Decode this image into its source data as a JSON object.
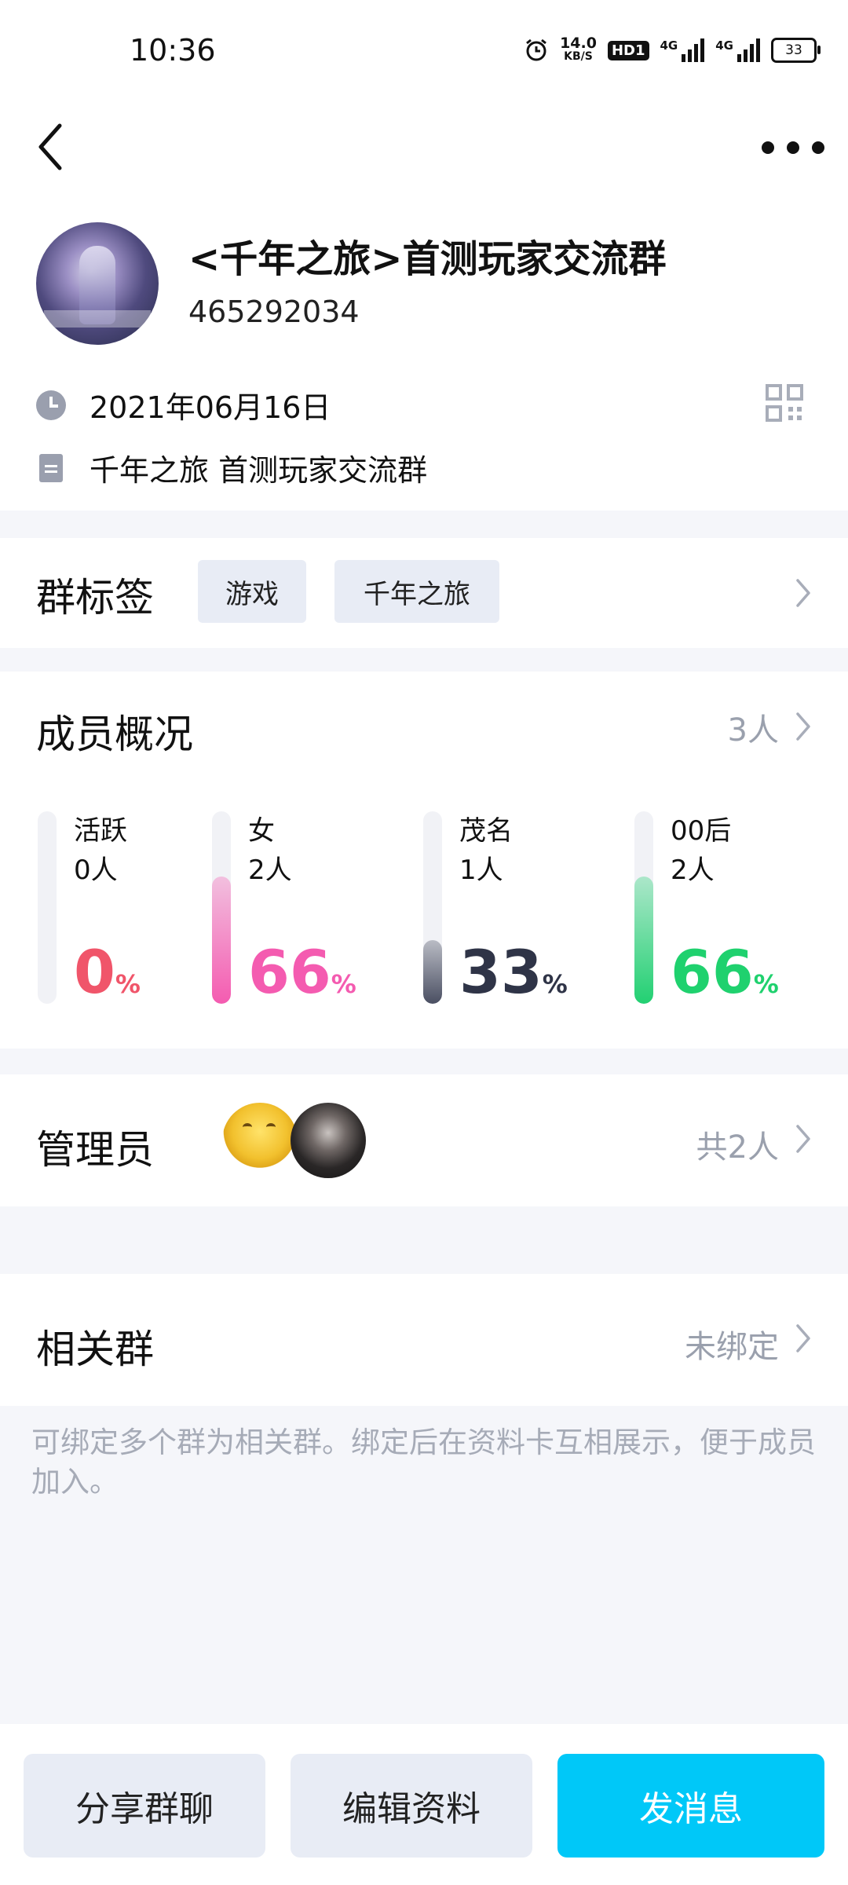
{
  "status_bar": {
    "time": "10:36",
    "speed_value": "14.0",
    "speed_unit": "KB/S",
    "hd_label": "HD1",
    "network1": "4G",
    "network2": "4G",
    "battery": "33"
  },
  "group": {
    "name": "<千年之旅>首测玩家交流群",
    "id": "465292034",
    "created_date": "2021年06月16日",
    "description": "千年之旅 首测玩家交流群"
  },
  "tags": {
    "title": "群标签",
    "items": [
      "游戏",
      "千年之旅"
    ]
  },
  "members": {
    "title": "成员概况",
    "count": "3人",
    "stats": [
      {
        "label": "活跃",
        "count": "0人",
        "percent": "0",
        "unit": "%",
        "fill": 0,
        "color": "#f0556a",
        "fill_color": "#f0556a"
      },
      {
        "label": "女",
        "count": "2人",
        "percent": "66",
        "unit": "%",
        "fill": 0.66,
        "color": "#f45bb0",
        "fill_color": "#f45bb0"
      },
      {
        "label": "茂名",
        "count": "1人",
        "percent": "33",
        "unit": "%",
        "fill": 0.33,
        "color": "#2f3447",
        "fill_color": "#4a4f62"
      },
      {
        "label": "00后",
        "count": "2人",
        "percent": "66",
        "unit": "%",
        "fill": 0.66,
        "color": "#1fd16e",
        "fill_color": "#22d072"
      }
    ]
  },
  "admins": {
    "title": "管理员",
    "count": "共2人"
  },
  "related": {
    "title": "相关群",
    "status": "未绑定",
    "hint": "可绑定多个群为相关群。绑定后在资料卡互相展示，便于成员加入。"
  },
  "actions": {
    "share": "分享群聊",
    "edit": "编辑资料",
    "message": "发消息"
  },
  "colors": {
    "accent": "#00c8f8",
    "page_bg": "#f5f6fa",
    "muted": "#9aa0ad"
  }
}
